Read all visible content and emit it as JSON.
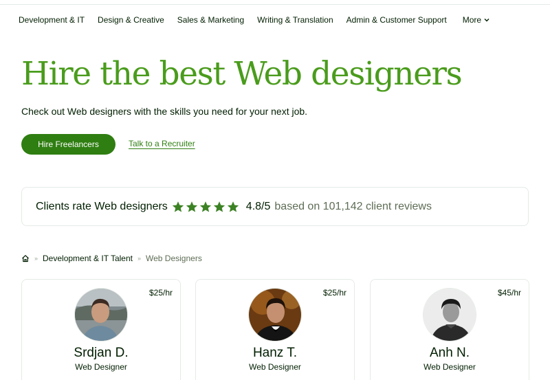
{
  "nav": {
    "items": [
      {
        "label": "Development & IT"
      },
      {
        "label": "Design & Creative"
      },
      {
        "label": "Sales & Marketing"
      },
      {
        "label": "Writing & Translation"
      },
      {
        "label": "Admin & Customer Support"
      }
    ],
    "more_label": "More"
  },
  "hero": {
    "title": "Hire the best Web designers",
    "subtitle": "Check out Web designers with the skills you need for your next job.",
    "primary_button": "Hire Freelancers",
    "secondary_link": "Talk to a Recruiter"
  },
  "rating": {
    "label": "Clients rate Web designers",
    "stars_count": 5,
    "score": "4.8/5",
    "reviews": "based on 101,142 client reviews"
  },
  "breadcrumb": {
    "separator": "»",
    "parent": "Development & IT Talent",
    "current": "Web Designers"
  },
  "freelancers": [
    {
      "name": "Srdjan D.",
      "role": "Web Designer",
      "rate": "$25/hr"
    },
    {
      "name": "Hanz T.",
      "role": "Web Designer",
      "rate": "$25/hr"
    },
    {
      "name": "Anh N.",
      "role": "Web Designer",
      "rate": "$45/hr"
    }
  ],
  "colors": {
    "brand_green": "#4a9c1c",
    "button_green": "#2f7e11",
    "star_green": "#3c8224",
    "text_dark": "#001e00",
    "text_muted": "#5e6d55"
  }
}
